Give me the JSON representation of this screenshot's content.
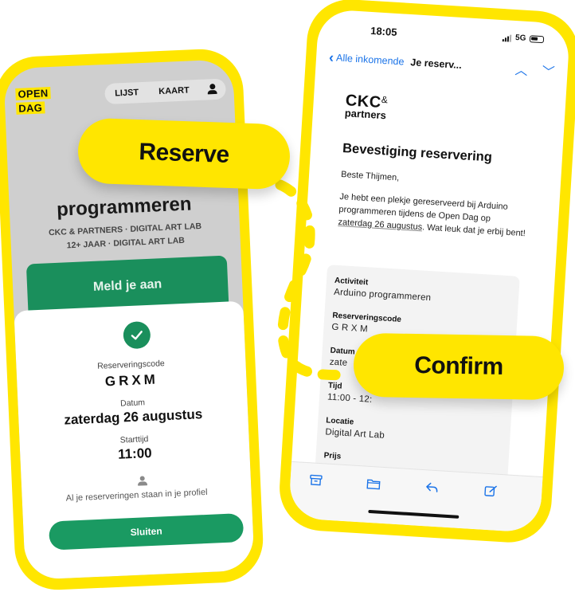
{
  "left_app": {
    "logo_line1": "OPEN",
    "logo_line2": "DAG",
    "nav_list": "LIJST",
    "nav_map": "KAART",
    "event_title": "programmeren",
    "event_meta_line1": "CKC & PARTNERS · DIGITAL ART LAB",
    "event_meta_line2": "12+ JAAR · DIGITAL ART LAB",
    "signup_button": "Meld je aan",
    "sheet": {
      "code_label": "Reserveringscode",
      "code_value": "GRXM",
      "date_label": "Datum",
      "date_value": "zaterdag 26 augustus",
      "time_label": "Starttijd",
      "time_value": "11:00",
      "profile_note": "Al je reserveringen staan in je profiel",
      "close_button": "Sluiten"
    }
  },
  "mail_app": {
    "status_time": "18:05",
    "network": "5G",
    "back_label": "Alle inkomende",
    "subject": "Je reserv...",
    "logo_ckc": "CKC",
    "logo_amp": "&",
    "logo_partners": "partners",
    "heading": "Bevestiging reservering",
    "greeting": "Beste Thijmen,",
    "body_part1": "Je hebt een plekje gereserveerd bij Arduino programmeren tijdens de Open Dag op ",
    "body_date": "zaterdag 26 augustus",
    "body_part2": ". Wat leuk dat je erbij bent!",
    "details": {
      "activity_label": "Activiteit",
      "activity_value": "Arduino programmeren",
      "code_label": "Reserveringscode",
      "code_value": "G R X M",
      "date_label": "Datum",
      "date_value": "zate",
      "time_label": "Tijd",
      "time_value": "11:00 - 12:",
      "location_label": "Locatie",
      "location_value": "Digital Art Lab",
      "price_label": "Prijs"
    },
    "tabbar_icons": [
      "archive-icon",
      "folder-icon",
      "reply-icon",
      "compose-icon"
    ]
  },
  "callouts": {
    "reserve": "Reserve",
    "confirm": "Confirm"
  },
  "colors": {
    "brand_yellow": "#ffe600",
    "action_green": "#1a8f5c",
    "link_blue": "#1a73e8"
  }
}
